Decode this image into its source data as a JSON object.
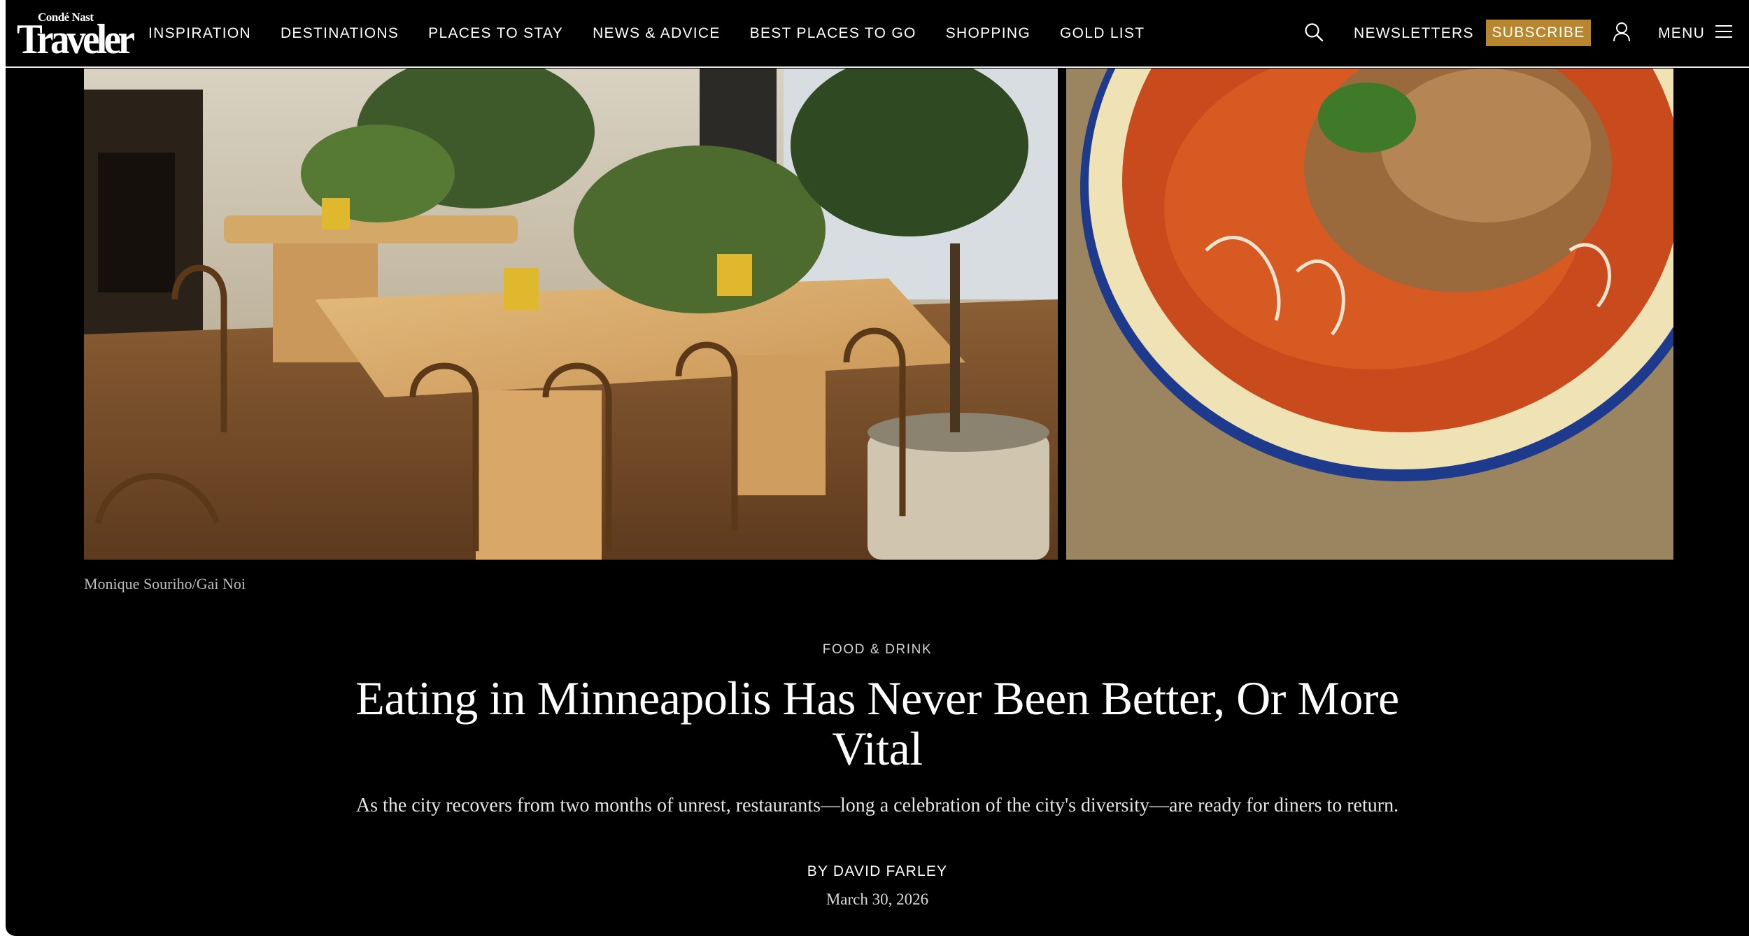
{
  "brand": {
    "logo_small": "Condé Nast",
    "logo_big": "Traveler"
  },
  "nav": {
    "items": [
      {
        "label": "INSPIRATION"
      },
      {
        "label": "DESTINATIONS"
      },
      {
        "label": "PLACES TO STAY"
      },
      {
        "label": "NEWS & ADVICE"
      },
      {
        "label": "BEST PLACES TO GO"
      },
      {
        "label": "SHOPPING"
      },
      {
        "label": "GOLD LIST"
      }
    ]
  },
  "header": {
    "search_icon": "search-icon",
    "newsletters_label": "NEWSLETTERS",
    "subscribe_label": "SUBSCRIBE",
    "account_icon": "account-icon",
    "menu_label": "MENU",
    "menu_icon": "hamburger-icon"
  },
  "hero": {
    "left_image": "restaurant-dining-room-photo",
    "right_image": "curry-noodle-bowl-photo",
    "caption": "Monique Souriho/Gai Noi"
  },
  "article": {
    "rubric": "FOOD & DRINK",
    "headline": "Eating in Minneapolis Has Never Been Better, Or More Vital",
    "dek": "As the city recovers from two months of unrest, restaurants—long a celebration of the city's diversity—are ready for diners to return.",
    "byline_prefix": "BY ",
    "author": "DAVID FARLEY",
    "date": "March 30, 2026"
  },
  "colors": {
    "background": "#000000",
    "subscribe_bg": "#b8862e",
    "text": "#ffffff"
  }
}
